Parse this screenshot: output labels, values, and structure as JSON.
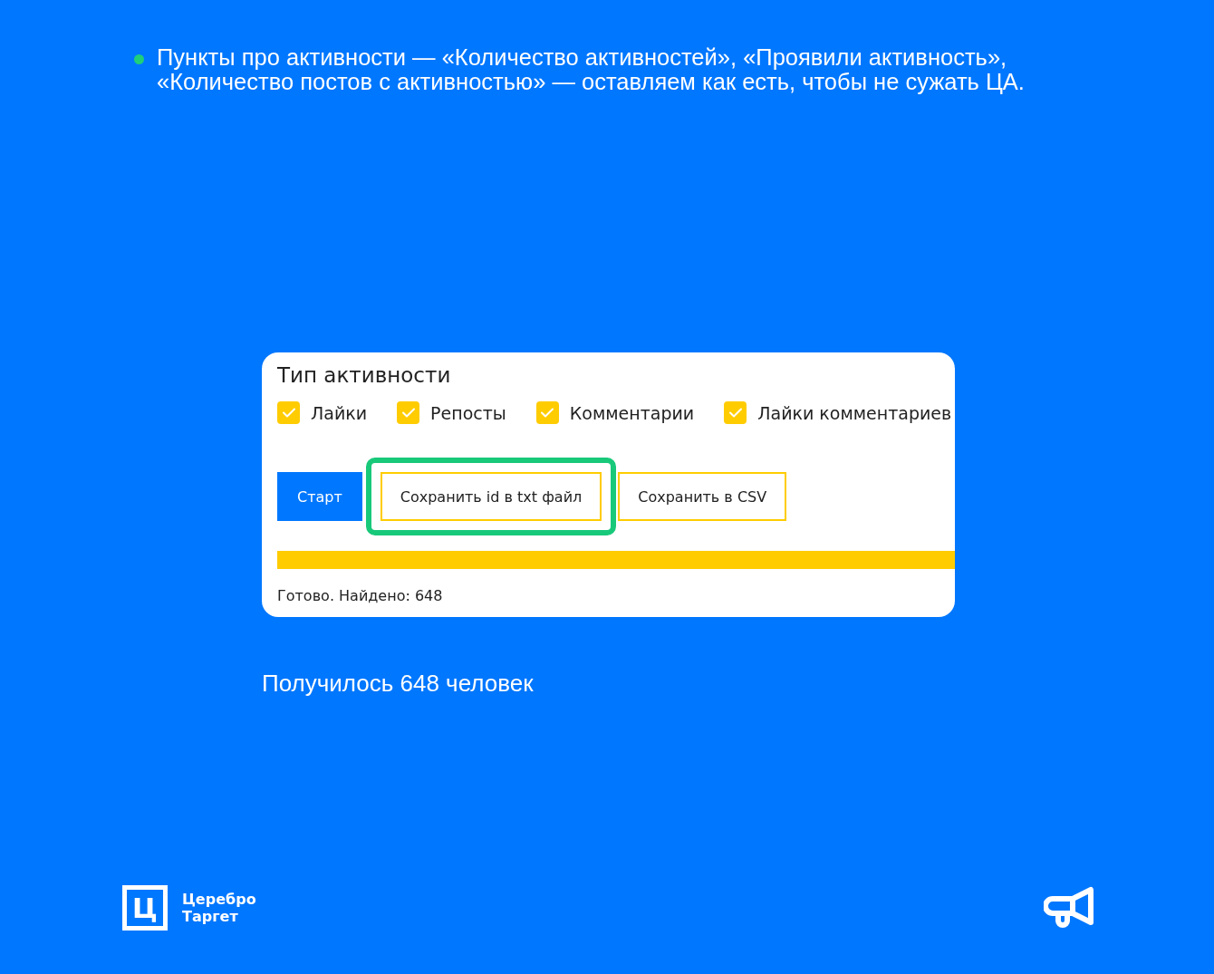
{
  "note": {
    "text": "Пункты про активности — «Количество активностей», «Проявили активность», «Количество постов с активностью» — оставляем как есть, чтобы не сужать ЦА."
  },
  "panel": {
    "title": "Тип активности",
    "checkboxes": [
      {
        "label": "Лайки",
        "checked": true
      },
      {
        "label": "Репосты",
        "checked": true
      },
      {
        "label": "Комментарии",
        "checked": true
      },
      {
        "label": "Лайки комментариев",
        "checked": true
      }
    ],
    "buttons": [
      {
        "label": "Старт",
        "kind": "primary",
        "highlighted": false
      },
      {
        "label": "Сохранить id в txt файл",
        "kind": "outline",
        "highlighted": true
      },
      {
        "label": "Сохранить в CSV",
        "kind": "outline",
        "highlighted": false
      }
    ],
    "progress": {
      "level": 1
    },
    "status": "Готово. Найдено: 648"
  },
  "caption": "Получилось 648 человек",
  "logo": {
    "mark": "Ц",
    "lines": [
      "Церебро",
      "Таргет"
    ]
  }
}
